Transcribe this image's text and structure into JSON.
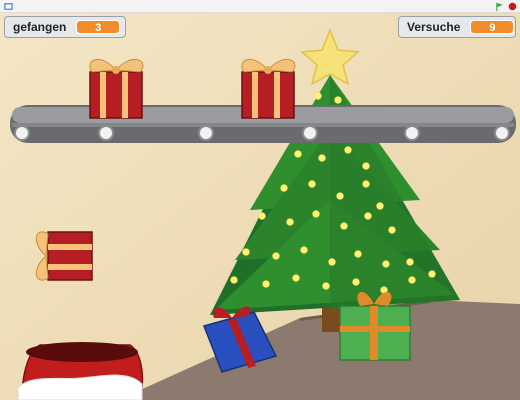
{
  "monitors": {
    "caught": {
      "label": "gefangen",
      "value": "3"
    },
    "tries": {
      "label": "Versuche",
      "value": "9"
    }
  },
  "controls": {
    "green_flag": "green-flag-icon",
    "stop": "stop-icon",
    "fullscreen": "fullscreen-icon"
  },
  "colors": {
    "gift_red": "#b51f24",
    "gift_ribbon": "#f4c27a",
    "tree_green": "#2f8f2f",
    "light_yellow": "#fff176",
    "conveyor_gray": "#7c7d80"
  }
}
